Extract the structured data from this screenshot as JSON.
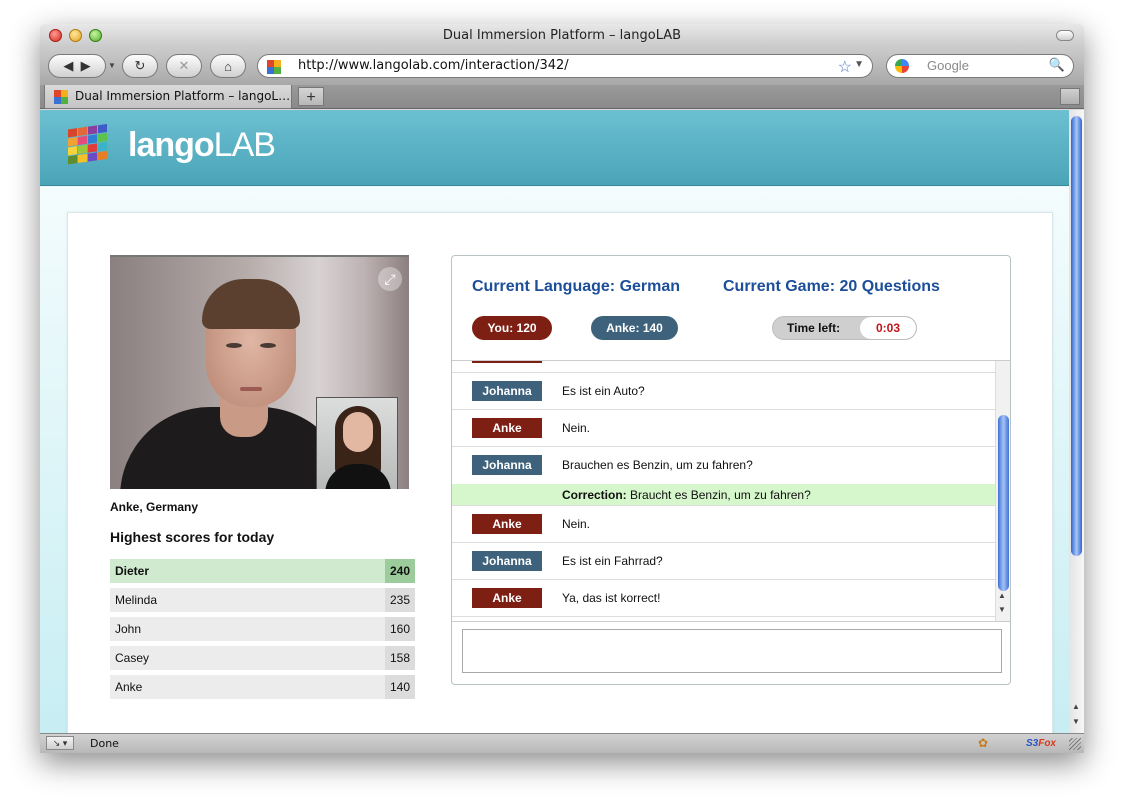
{
  "window": {
    "title": "Dual Immersion Platform – langoLAB"
  },
  "toolbar": {
    "url": "http://www.langolab.com/interaction/342/",
    "search_placeholder": "Google"
  },
  "tab": {
    "label": "Dual Immersion Platform – langoL…",
    "new_tab": "+"
  },
  "site": {
    "logo_bold": "lango",
    "logo_light": "LAB"
  },
  "video": {
    "caption": "Anke, Germany"
  },
  "scores": {
    "title": "Highest scores for today",
    "rows": [
      {
        "name": "Dieter",
        "score": "240"
      },
      {
        "name": "Melinda",
        "score": "235"
      },
      {
        "name": "John",
        "score": "160"
      },
      {
        "name": "Casey",
        "score": "158"
      },
      {
        "name": "Anke",
        "score": "140"
      }
    ]
  },
  "game": {
    "language": "Current Language: German",
    "game": "Current Game: 20 Questions",
    "you": "You: 120",
    "other": "Anke: 140",
    "time_label": "Time left:",
    "time_value": "0:03"
  },
  "chat": {
    "messages": [
      {
        "who": "Johanna",
        "text": "Es ist ein Auto?"
      },
      {
        "who": "Anke",
        "text": "Nein."
      },
      {
        "who": "Johanna",
        "text": "Brauchen es Benzin, um zu fahren?"
      },
      {
        "who": "Anke",
        "text": "Nein."
      },
      {
        "who": "Johanna",
        "text": "Es ist ein Fahrrad?"
      },
      {
        "who": "Anke",
        "text": "Ya, das ist korrect!"
      }
    ],
    "correction_label": "Correction:",
    "correction_text": "Braucht es Benzin, um zu fahren?"
  },
  "status": {
    "text": "Done",
    "ext_a": "S3",
    "ext_b": "Fox"
  },
  "colors": {
    "anke": "#7d1f13",
    "johanna": "#3e627c",
    "header": "#4aa4b8",
    "heading_blue": "#1d4e9a",
    "timer_red": "#c0151a"
  }
}
